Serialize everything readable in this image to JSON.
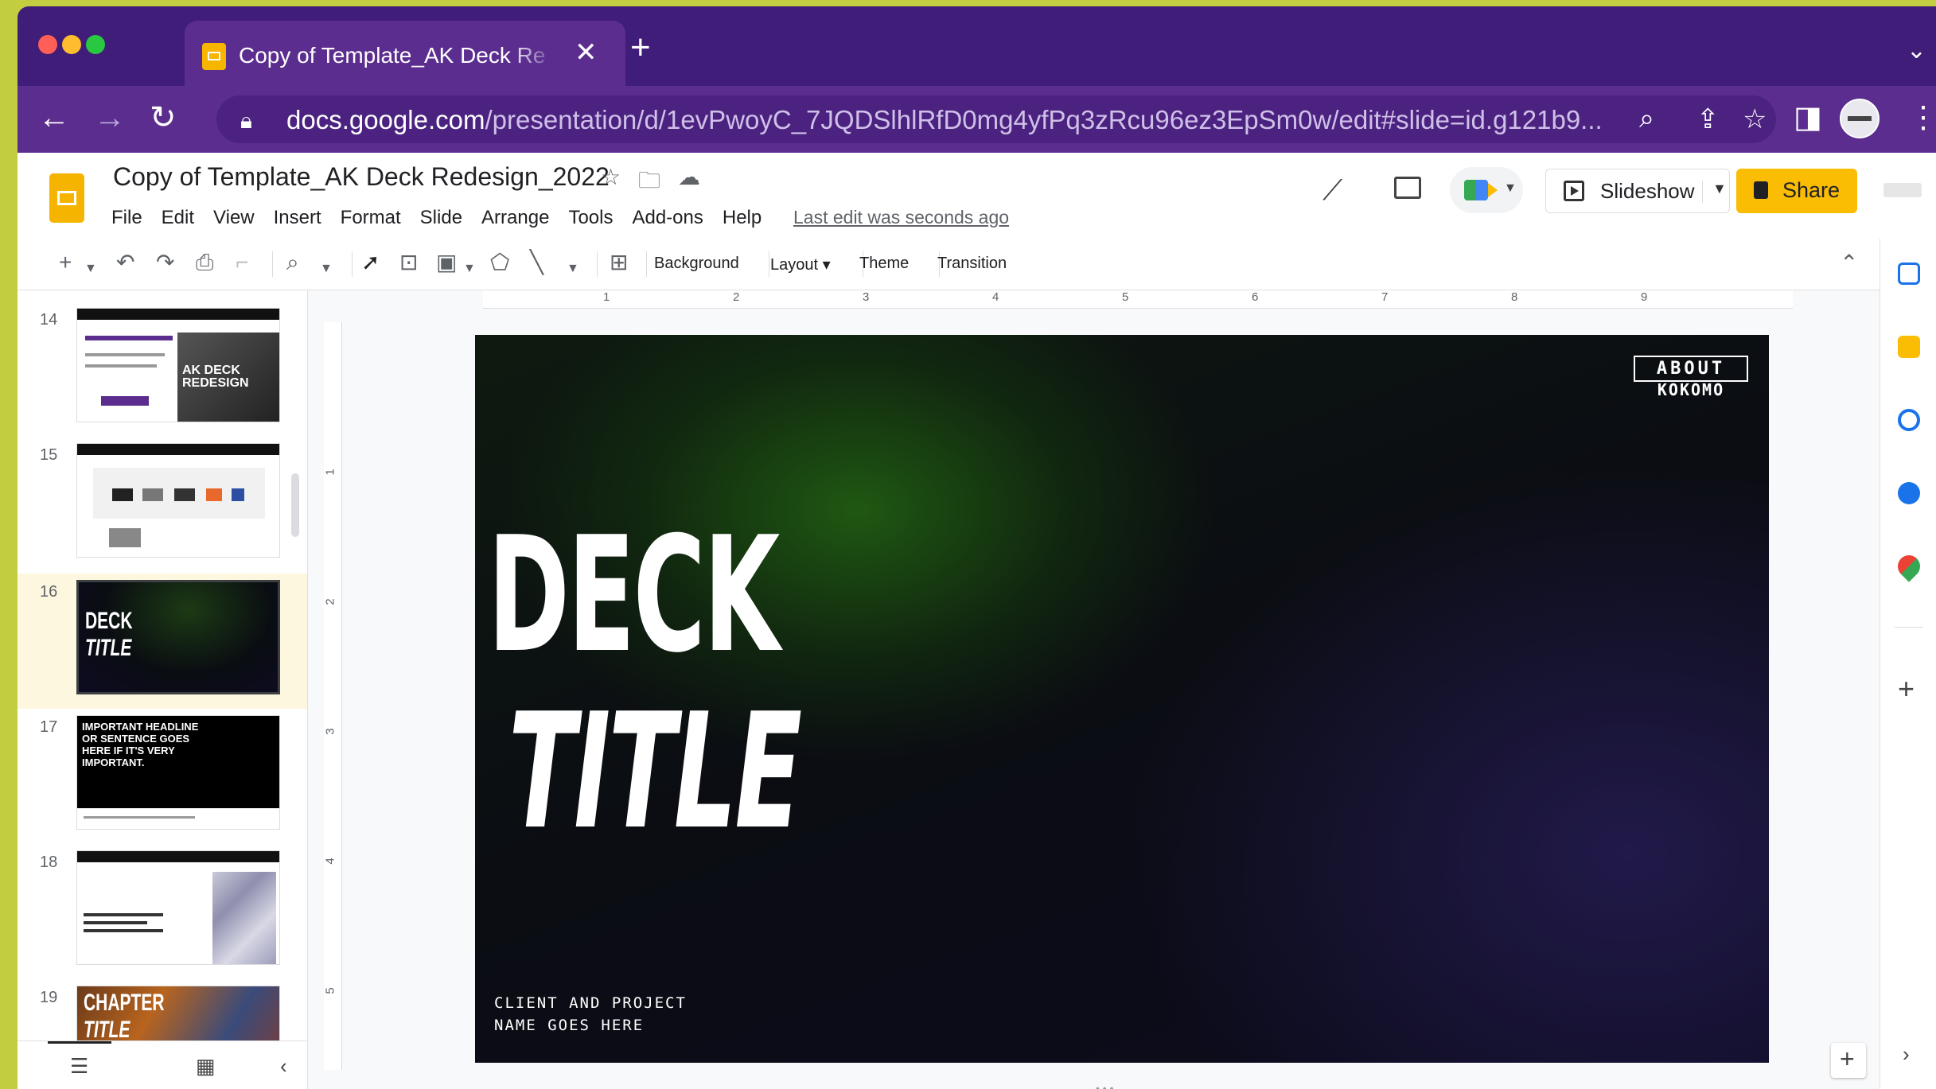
{
  "browser": {
    "tab_title": "Copy of Template_AK Deck Re",
    "tab_close": "✕",
    "new_tab": "+",
    "tab_menu": "⌄",
    "url_host": "docs.google.com",
    "url_path": "/presentation/d/1evPwoyC_7JQDSlhlRfD0mg4yfPq3zRcu96ez3EpSm0w/edit#slide=id.g121b9...",
    "traffic_colors": [
      "#ff5f57",
      "#febc2e",
      "#28c840"
    ]
  },
  "app": {
    "doc_title": "Copy of Template_AK Deck Redesign_2022",
    "menu": [
      "File",
      "Edit",
      "View",
      "Insert",
      "Format",
      "Slide",
      "Arrange",
      "Tools",
      "Add-ons",
      "Help"
    ],
    "last_edit": "Last edit was seconds ago",
    "slideshow_label": "Slideshow",
    "share_label": "Share",
    "brand_color": "#fbbc04"
  },
  "toolbar": {
    "background": "Background",
    "layout": "Layout ▾",
    "theme": "Theme",
    "transition": "Transition"
  },
  "ruler": {
    "h": [
      "1",
      "2",
      "3",
      "4",
      "5",
      "6",
      "7",
      "8",
      "9"
    ],
    "v": [
      "1",
      "2",
      "3",
      "4",
      "5"
    ]
  },
  "filmstrip": [
    {
      "num": "14",
      "title": "AK DECK REDESIGN"
    },
    {
      "num": "15",
      "title": ""
    },
    {
      "num": "16",
      "title_line1": "DECK",
      "title_line2": "TITLE",
      "selected": true
    },
    {
      "num": "17",
      "title": "IMPORTANT HEADLINE OR SENTENCE GOES HERE IF IT'S VERY IMPORTANT."
    },
    {
      "num": "18",
      "title": ""
    },
    {
      "num": "19",
      "title_line1": "CHAPTER",
      "title_line2": "TITLE"
    }
  ],
  "slide": {
    "title_line1": "DECK",
    "title_line2": "TITLE",
    "client_line1": "CLIENT AND PROJECT",
    "client_line2": "NAME GOES HERE",
    "logo_top": "ABOUT",
    "logo_bottom": "KOKOMO"
  }
}
